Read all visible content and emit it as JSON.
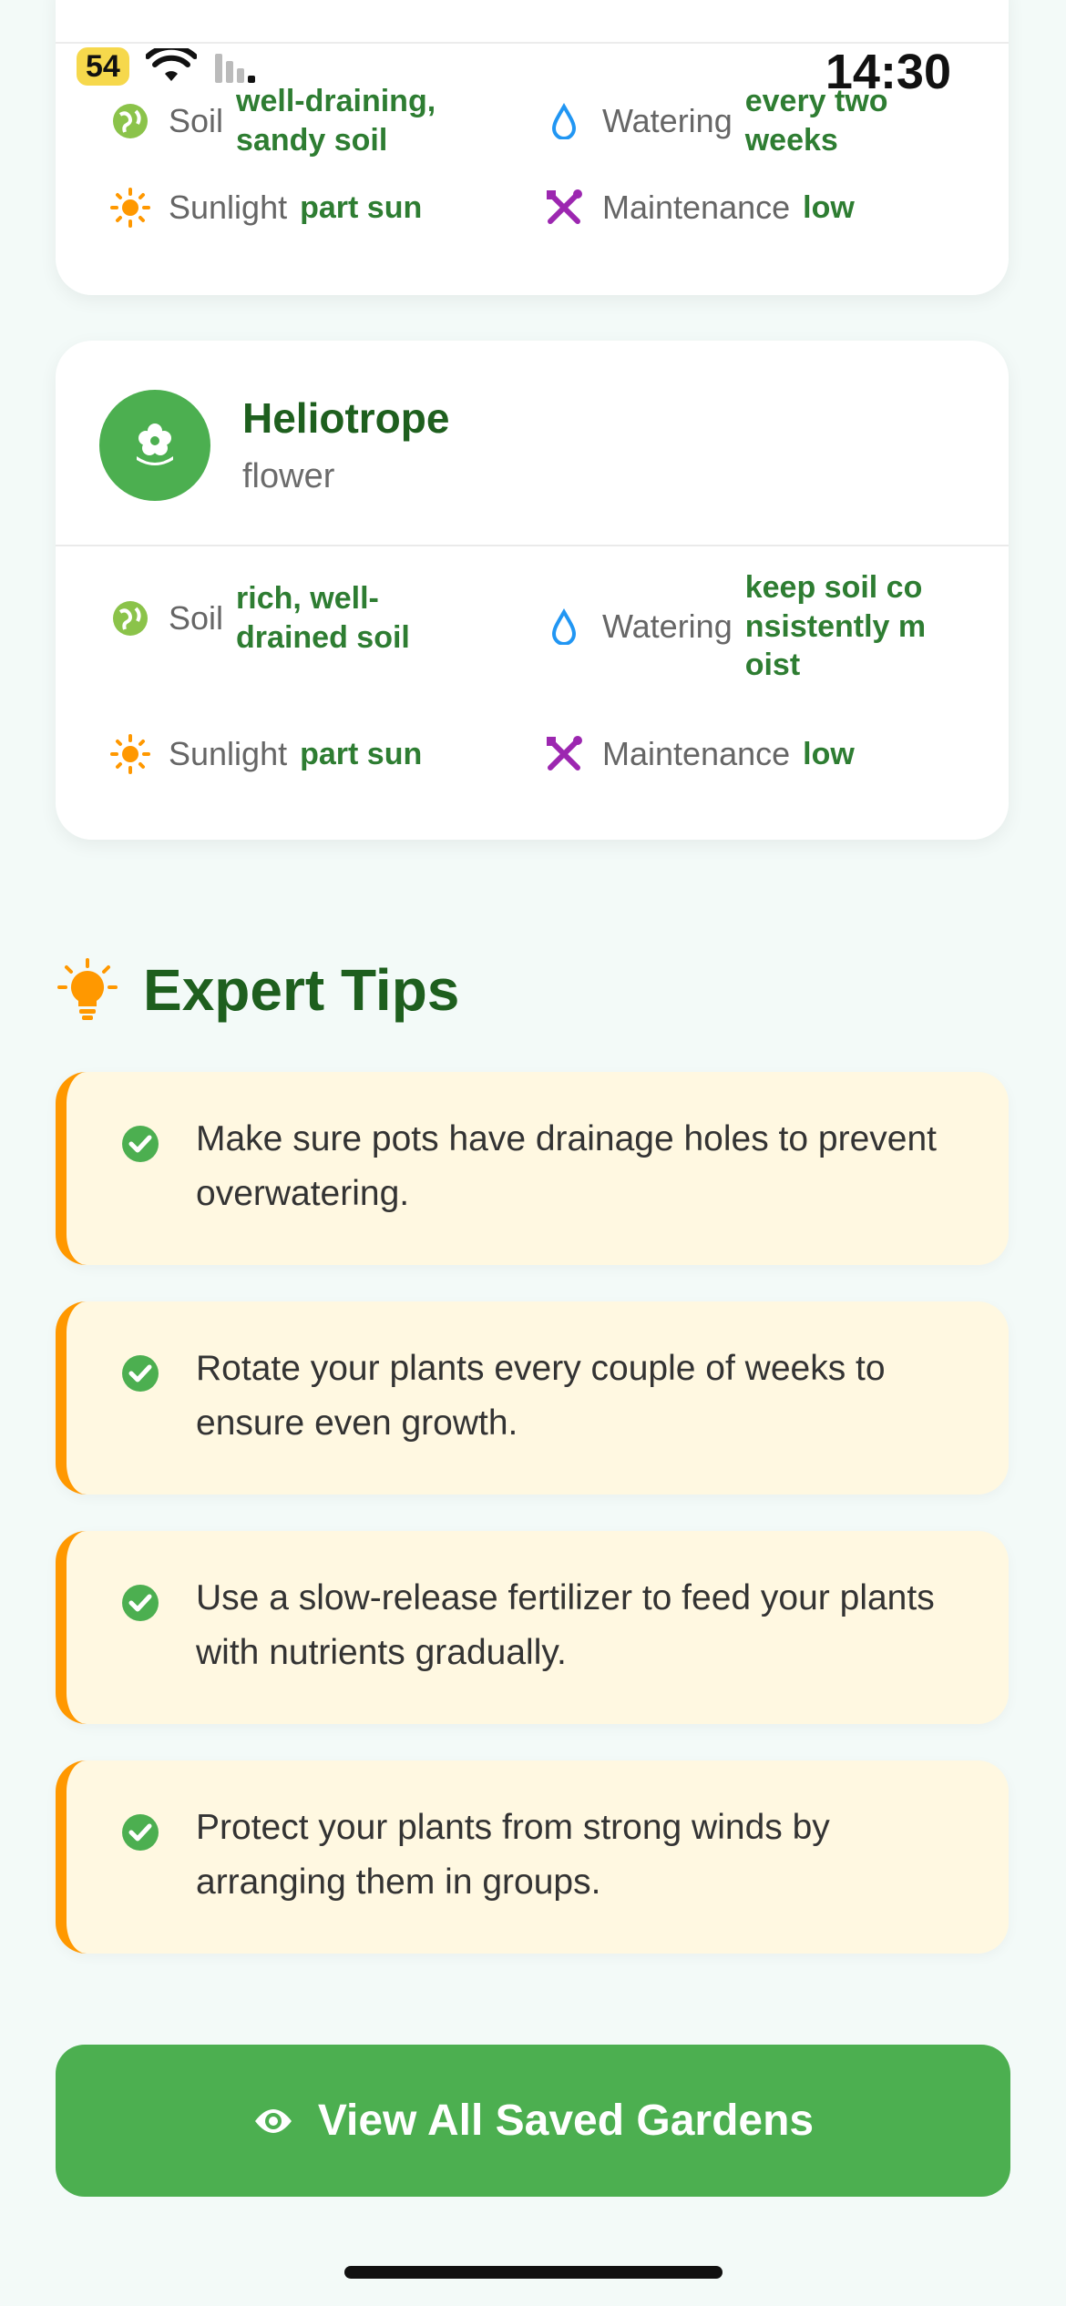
{
  "status_bar": {
    "time": "14:30",
    "battery": "54"
  },
  "top_card": {
    "attributes": [
      {
        "label": "Soil",
        "value": "well-draining, sandy soil",
        "icon": "globe-icon"
      },
      {
        "label": "Watering",
        "value": "every two weeks",
        "icon": "water-drop-icon"
      },
      {
        "label": "Sunlight",
        "value": "part sun",
        "icon": "sun-icon"
      },
      {
        "label": "Maintenance",
        "value": "low",
        "icon": "tools-icon"
      }
    ]
  },
  "heliotrope_card": {
    "name": "Heliotrope",
    "type": "flower",
    "attributes": [
      {
        "label": "Soil",
        "value": "rich, well-drained soil",
        "icon": "globe-icon"
      },
      {
        "label": "Watering",
        "value": "keep soil consistently moist",
        "icon": "water-drop-icon"
      },
      {
        "label": "Sunlight",
        "value": "part sun",
        "icon": "sun-icon"
      },
      {
        "label": "Maintenance",
        "value": "low",
        "icon": "tools-icon"
      }
    ]
  },
  "tips": {
    "title": "Expert Tips",
    "items": [
      "Make sure pots have drainage holes to prevent overwatering.",
      "Rotate your plants every couple of weeks to ensure even growth.",
      "Use a slow-release fertilizer to feed your plants with nutrients gradually.",
      "Protect your plants from strong winds by arranging them in groups."
    ]
  },
  "cta": {
    "label": "View All Saved Gardens"
  },
  "colors": {
    "primary": "#4CAF50",
    "title_green": "#1E5F1E",
    "value_green": "#2E7D32",
    "tip_bg": "#FFF8E1",
    "tip_accent": "#FF9800",
    "maintenance_purple": "#9C27B0",
    "water_blue": "#2196F3"
  }
}
